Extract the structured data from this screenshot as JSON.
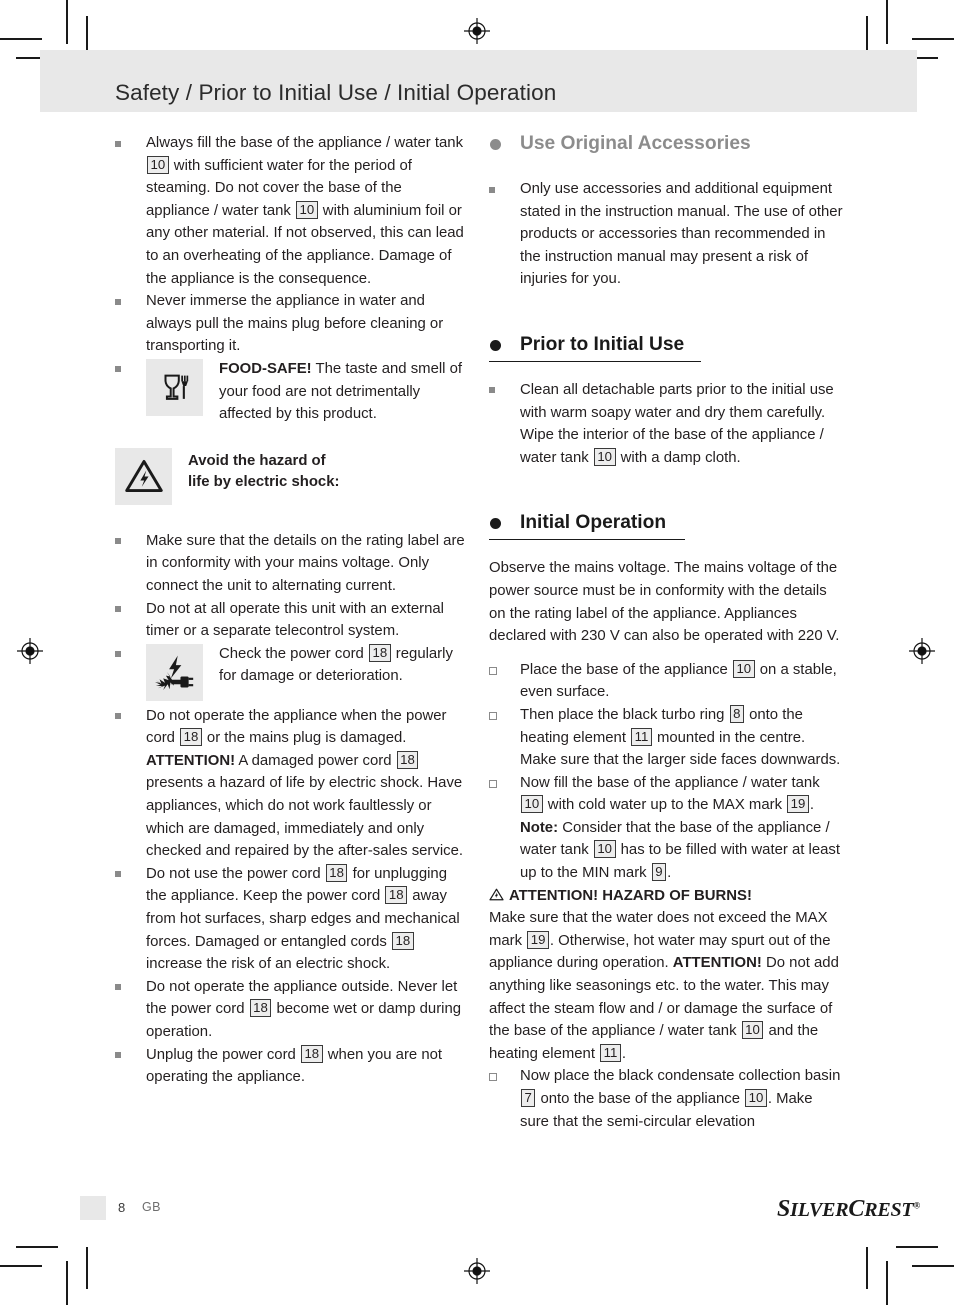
{
  "page": {
    "header_title": "Safety / Prior to Initial Use / Initial Operation",
    "number": "8",
    "language": "GB",
    "brand": "SILVERCREST",
    "brand_parts": {
      "s": "S",
      "ilver": "ILVER",
      "c": "C",
      "rest": "REST",
      "reg": "®"
    }
  },
  "left_column": {
    "bullets": [
      {
        "id": "fill-base",
        "text_parts": [
          {
            "t": "Always fill the base of the appliance / water tank "
          },
          {
            "ref": "10"
          },
          {
            "t": " with sufficient water for the period of steaming. Do not cover the base of the appliance / water tank "
          },
          {
            "ref": "10"
          },
          {
            "t": " with aluminium foil or any other material. If not observed, this can lead to an overheating of the appliance. Damage of the appliance is the consequence."
          }
        ]
      },
      {
        "id": "never-immerse",
        "text_parts": [
          {
            "t": "Never immerse the appliance in water and always pull the mains plug before cleaning or transporting it."
          }
        ]
      },
      {
        "id": "food-safe",
        "icon": "glass-and-fork-icon",
        "text_parts": [
          {
            "b": "FOOD-SAFE!"
          },
          {
            "t": " The taste and smell of your food are not detrimentally affected by this product."
          }
        ]
      }
    ],
    "warning_block": {
      "icon": "electric-shock-triangle-icon",
      "line1": "Avoid the hazard of",
      "line2": "life by electric shock:"
    },
    "bullets2": [
      {
        "id": "rating-label",
        "text_parts": [
          {
            "t": "Make sure that the details on the rating label are in conformity with your mains voltage. Only connect the unit to alternating current."
          }
        ]
      },
      {
        "id": "no-external-timer",
        "text_parts": [
          {
            "t": "Do not at all operate this unit with an external timer or a separate telecontrol system."
          }
        ]
      },
      {
        "id": "check-power-cord",
        "icon": "damaged-plug-icon",
        "text_parts": [
          {
            "t": "Check the power cord "
          },
          {
            "ref": "18"
          },
          {
            "t": " regularly for damage or deterioration."
          }
        ]
      },
      {
        "id": "damaged-cord",
        "text_parts": [
          {
            "t": "Do not operate the appliance when the power cord "
          },
          {
            "ref": "18"
          },
          {
            "t": " or the mains plug is damaged. "
          },
          {
            "b": "ATTENTION!"
          },
          {
            "t": " A damaged power cord "
          },
          {
            "ref": "18"
          },
          {
            "t": " presents a hazard of life by electric shock. Have appliances, which do not work faultlessly or which are damaged, immediately and only checked and repaired by the after-sales service."
          }
        ]
      },
      {
        "id": "no-unplug-by-cord",
        "text_parts": [
          {
            "t": "Do not use the power cord "
          },
          {
            "ref": "18"
          },
          {
            "t": " for unplugging the appliance. Keep the power cord "
          },
          {
            "ref": "18"
          },
          {
            "t": " away from hot surfaces, sharp edges and mechanical forces. Damaged or entangled cords "
          },
          {
            "ref": "18"
          },
          {
            "t": " increase the risk of an electric shock."
          }
        ]
      },
      {
        "id": "no-outside-use",
        "text_parts": [
          {
            "t": "Do not operate the appliance outside. Never let the power cord "
          },
          {
            "ref": "18"
          },
          {
            "t": " become wet or damp during operation."
          }
        ]
      },
      {
        "id": "unplug-when-unused",
        "text_parts": [
          {
            "t": "Unplug the power cord "
          },
          {
            "ref": "18"
          },
          {
            "t": " when you are not operating the appliance."
          }
        ]
      }
    ]
  },
  "right_column": {
    "section_accessories": {
      "heading": "Use Original Accessories",
      "bullets": [
        {
          "id": "only-stated-accessories",
          "text_parts": [
            {
              "t": "Only use accessories and additional equipment stated in the instruction manual. The use of other products or accessories than recommended in the instruction manual may present a risk of injuries for you."
            }
          ]
        }
      ]
    },
    "section_prior": {
      "heading": "Prior to Initial Use",
      "bullets": [
        {
          "id": "clean-detachable-parts",
          "text_parts": [
            {
              "t": "Clean all detachable parts prior to the initial use with warm soapy water and dry them carefully. Wipe the interior of the base of the appliance / water tank "
            },
            {
              "ref": "10"
            },
            {
              "t": " with a damp cloth."
            }
          ]
        }
      ]
    },
    "section_initial_operation": {
      "heading": "Initial Operation",
      "intro_parts": [
        {
          "t": "Observe the mains voltage. The mains voltage of the power source must be in conformity with the details on the rating label of the appliance. Appliances declared with 230 V can also be operated with 220 V."
        }
      ],
      "steps": [
        {
          "id": "place-base",
          "text_parts": [
            {
              "t": "Place the base of the appliance "
            },
            {
              "ref": "10"
            },
            {
              "t": " on a stable, even surface."
            }
          ]
        },
        {
          "id": "place-turbo-ring",
          "text_parts": [
            {
              "t": "Then place the black turbo ring "
            },
            {
              "ref": "8"
            },
            {
              "t": " onto the heating element "
            },
            {
              "ref": "11"
            },
            {
              "t": " mounted in the centre. Make sure that the larger side faces downwards."
            }
          ]
        },
        {
          "id": "fill-cold-water",
          "text_parts": [
            {
              "t": "Now fill the base of the appliance / water tank "
            },
            {
              "ref": "10"
            },
            {
              "t": " with cold water up to the MAX mark "
            },
            {
              "ref": "19"
            },
            {
              "t": ". "
            },
            {
              "b": "Note:"
            },
            {
              "t": " Consider that the base of the appliance / water tank "
            },
            {
              "ref": "10"
            },
            {
              "t": " has to be filled with water at least up to the MIN mark "
            },
            {
              "ref": "9"
            },
            {
              "t": "."
            }
          ]
        }
      ],
      "attention_block": {
        "icon": "warning-triangle-icon",
        "title": "ATTENTION! HAZARD OF BURNS!",
        "body_parts": [
          {
            "t": "Make sure that the water does not exceed the MAX mark "
          },
          {
            "ref": "19"
          },
          {
            "t": ". Otherwise, hot water may spurt out of the appliance during operation. "
          },
          {
            "b": "ATTENTION!"
          },
          {
            "t": " Do not add anything like seasonings etc. to the water. This may affect the steam flow and / or damage the surface of the base of the appliance / water tank "
          },
          {
            "ref": "10"
          },
          {
            "t": " and the heating element "
          },
          {
            "ref": "11"
          },
          {
            "t": "."
          }
        ]
      },
      "steps2": [
        {
          "id": "place-condensate-basin",
          "text_parts": [
            {
              "t": "Now place the black condensate collection basin "
            },
            {
              "ref": "7"
            },
            {
              "t": " onto the base of the appliance "
            },
            {
              "ref": "10"
            },
            {
              "t": ". Make sure that the semi-circular elevation"
            }
          ]
        }
      ]
    }
  },
  "colors": {
    "header_bg": "#e8e8e8",
    "heading_grey": "#8c8c8c",
    "heading_dark": "#1a1a1a",
    "text": "#231f20",
    "ref_bg": "#ededed"
  }
}
